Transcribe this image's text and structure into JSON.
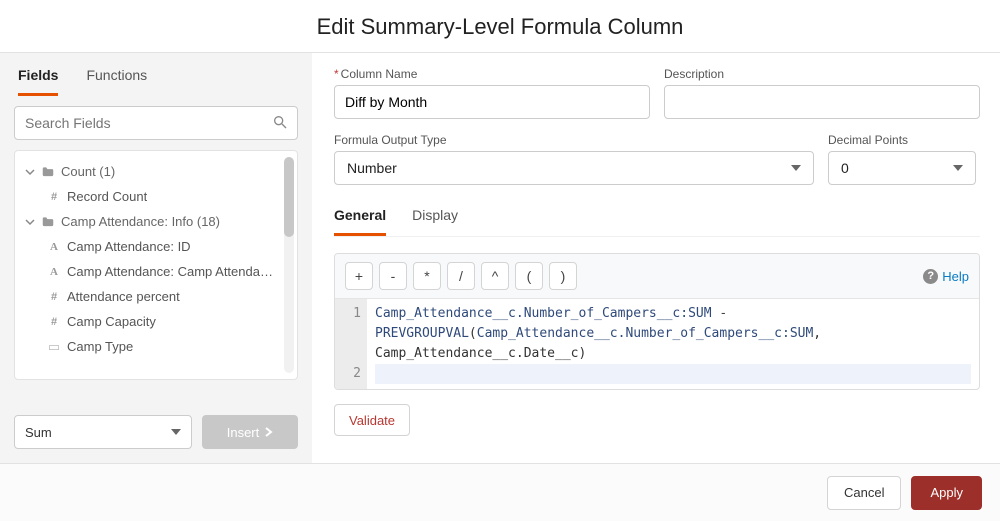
{
  "title": "Edit Summary-Level Formula Column",
  "left": {
    "tabs": {
      "fields": "Fields",
      "functions": "Functions"
    },
    "search_placeholder": "Search Fields",
    "groups": [
      {
        "label": "Count (1)",
        "items": [
          {
            "icon": "hash",
            "label": "Record Count"
          }
        ]
      },
      {
        "label": "Camp Attendance: Info (18)",
        "items": [
          {
            "icon": "a",
            "label": "Camp Attendance: ID"
          },
          {
            "icon": "a",
            "label": "Camp Attendance: Camp Attendance"
          },
          {
            "icon": "hash",
            "label": "Attendance percent"
          },
          {
            "icon": "hash",
            "label": "Camp Capacity"
          },
          {
            "icon": "type",
            "label": "Camp Type"
          }
        ]
      }
    ],
    "aggregate": "Sum",
    "insert_label": "Insert"
  },
  "form": {
    "column_name_label": "Column Name",
    "column_name_value": "Diff by Month",
    "description_label": "Description",
    "description_value": "",
    "output_type_label": "Formula Output Type",
    "output_type_value": "Number",
    "decimal_label": "Decimal Points",
    "decimal_value": "0"
  },
  "editor": {
    "tabs": {
      "general": "General",
      "display": "Display"
    },
    "ops": [
      "+",
      "-",
      "*",
      "/",
      "^",
      "(",
      ")"
    ],
    "help_label": "Help",
    "gutter": [
      "1",
      "2"
    ],
    "code": {
      "seg1": "Camp_Attendance__c.Number_of_Campers__c:SUM",
      "seg2": " - ",
      "seg3": "PREVGROUPVAL",
      "seg4": "(",
      "seg5": "Camp_Attendance__c.Number_of_Campers__c:SUM",
      "seg6": ", Camp_Attendance__c.Date__c",
      "seg7": ")"
    },
    "validate_label": "Validate"
  },
  "footer": {
    "cancel": "Cancel",
    "apply": "Apply"
  }
}
